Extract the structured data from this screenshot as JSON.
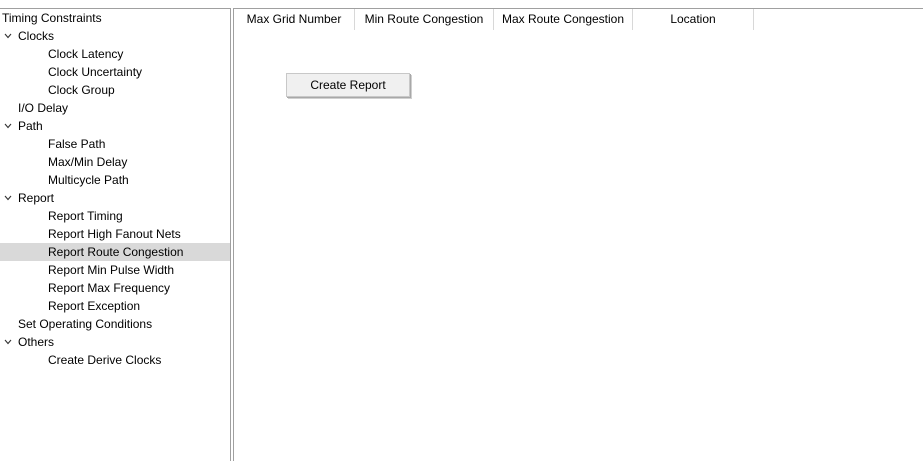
{
  "tree": {
    "items": [
      {
        "label": "Timing Constraints",
        "level": 0,
        "expandable": false
      },
      {
        "label": "Clocks",
        "level": 0,
        "expandable": true
      },
      {
        "label": "Clock Latency",
        "level": 2,
        "expandable": false
      },
      {
        "label": "Clock Uncertainty",
        "level": 2,
        "expandable": false
      },
      {
        "label": "Clock Group",
        "level": 2,
        "expandable": false
      },
      {
        "label": "I/O Delay",
        "level": 1,
        "expandable": false
      },
      {
        "label": "Path",
        "level": 0,
        "expandable": true
      },
      {
        "label": "False Path",
        "level": 2,
        "expandable": false
      },
      {
        "label": "Max/Min Delay",
        "level": 2,
        "expandable": false
      },
      {
        "label": "Multicycle Path",
        "level": 2,
        "expandable": false
      },
      {
        "label": "Report",
        "level": 0,
        "expandable": true
      },
      {
        "label": "Report Timing",
        "level": 2,
        "expandable": false
      },
      {
        "label": "Report High Fanout Nets",
        "level": 2,
        "expandable": false
      },
      {
        "label": "Report Route Congestion",
        "level": 2,
        "expandable": false,
        "selected": true
      },
      {
        "label": "Report Min Pulse Width",
        "level": 2,
        "expandable": false
      },
      {
        "label": "Report Max Frequency",
        "level": 2,
        "expandable": false
      },
      {
        "label": "Report Exception",
        "level": 2,
        "expandable": false
      },
      {
        "label": "Set Operating Conditions",
        "level": 1,
        "expandable": false
      },
      {
        "label": "Others",
        "level": 0,
        "expandable": true
      },
      {
        "label": "Create Derive Clocks",
        "level": 2,
        "expandable": false
      }
    ]
  },
  "table": {
    "columns": [
      "Max Grid Number",
      "Min Route Congestion",
      "Max Route Congestion",
      "Location"
    ]
  },
  "actions": {
    "create_report_label": "Create Report"
  },
  "colors": {
    "selected_row": "#d9d9d9",
    "panel_border": "#a0a0a0",
    "button_face": "#f0f0f0"
  }
}
